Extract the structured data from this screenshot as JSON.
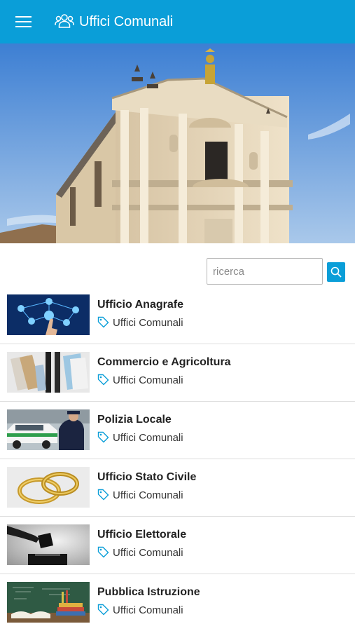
{
  "header": {
    "menu_icon": "hamburger-menu-icon",
    "title_icon": "people-group-icon",
    "title": "Uffici Comunali",
    "color": "#0a9ed8"
  },
  "hero": {
    "subject": "church facade"
  },
  "search": {
    "placeholder": "ricerca",
    "value": "",
    "button_icon": "search-icon"
  },
  "offices": [
    {
      "title": "Ufficio Anagrafe",
      "tag": "Uffici Comunali",
      "thumb": "network-people"
    },
    {
      "title": "Commercio e Agricoltura",
      "tag": "Uffici Comunali",
      "thumb": "shopping"
    },
    {
      "title": "Polizia Locale",
      "tag": "Uffici Comunali",
      "thumb": "police"
    },
    {
      "title": "Ufficio Stato Civile",
      "tag": "Uffici Comunali",
      "thumb": "rings"
    },
    {
      "title": "Ufficio Elettorale",
      "tag": "Uffici Comunali",
      "thumb": "ballot"
    },
    {
      "title": "Pubblica Istruzione",
      "tag": "Uffici Comunali",
      "thumb": "school"
    }
  ],
  "tag_icon": "tag-icon",
  "accent": "#0a9ed8"
}
